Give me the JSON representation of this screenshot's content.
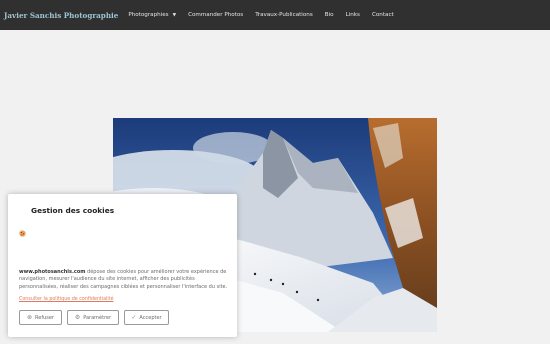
{
  "navbar": {
    "brand": "Javier Sanchis Photographie",
    "items": [
      {
        "label": "Photographies",
        "has_dropdown": true
      },
      {
        "label": "Commander Photos"
      },
      {
        "label": "Travaux-Publications"
      },
      {
        "label": "Bio"
      },
      {
        "label": "Links"
      },
      {
        "label": "Contact"
      }
    ]
  },
  "hero": {
    "subject": "snowy mountain with climbers"
  },
  "cookie_banner": {
    "title": "Gestion des cookies",
    "site": "www.photosanchis.com",
    "text": " dépose des cookies pour améliorer votre expérience de navigation, mesurer l'audience du site internet, afficher des publicités personnalisées, réaliser des campagnes ciblées et personnaliser l'interface du site.",
    "policy_link": "Consulter la politique de confidentialité",
    "buttons": {
      "refuse": "Refuser",
      "settings": "Paramétrer",
      "accept": "Accepter"
    }
  },
  "colors": {
    "navbar": "#303030",
    "brand": "#9ec3d3",
    "link": "#e07a5f"
  }
}
